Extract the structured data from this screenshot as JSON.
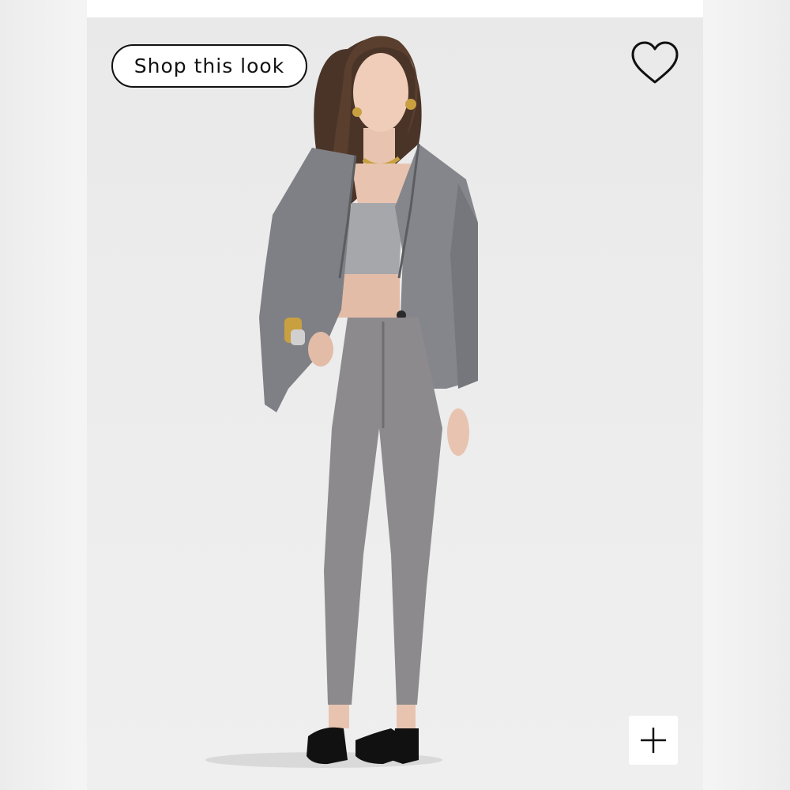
{
  "shop_button": {
    "label": "Shop this look"
  },
  "icons": {
    "favorite": "heart-outline-icon",
    "zoom": "plus-icon"
  },
  "colors": {
    "button_border": "#111111",
    "background": "#ececec"
  }
}
